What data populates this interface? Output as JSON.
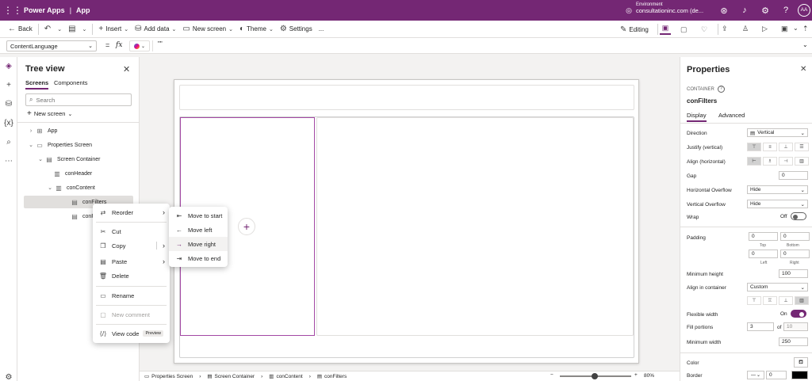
{
  "topbar": {
    "brand": "Power Apps",
    "separator": "|",
    "app": "App",
    "env_label": "Environment",
    "env_name": "consultationinc.com (de...",
    "avatar": "AA",
    "bg": "#742774"
  },
  "cmdbar": {
    "back": "Back",
    "insert": "Insert",
    "add_data": "Add data",
    "new_screen": "New screen",
    "theme": "Theme",
    "settings": "Settings",
    "more": "...",
    "editing": "Editing"
  },
  "formula": {
    "property": "ContentLanguage",
    "equals": "=",
    "fx": "fx",
    "value": "\"\""
  },
  "tree": {
    "title": "Tree view",
    "tabs": [
      "Screens",
      "Components"
    ],
    "search_placeholder": "Search",
    "new_screen": "New screen",
    "nodes": [
      "App",
      "Properties Screen",
      "Screen Container",
      "conHeader",
      "conContent",
      "conFilters",
      "conPro"
    ],
    "more": "..."
  },
  "context_menu": {
    "items": [
      "Reorder",
      "Cut",
      "Copy",
      "Paste",
      "Delete",
      "Rename",
      "New comment",
      "View code"
    ],
    "preview_badge": "Preview"
  },
  "submenu": {
    "items": [
      "Move to start",
      "Move left",
      "Move right",
      "Move to end"
    ]
  },
  "properties": {
    "title": "Properties",
    "kind": "CONTAINER",
    "name": "conFilters",
    "tabs": [
      "Display",
      "Advanced"
    ],
    "direction_label": "Direction",
    "direction_value": "Vertical",
    "justify_label": "Justify (vertical)",
    "align_h_label": "Align (horizontal)",
    "gap_label": "Gap",
    "gap_value": "0",
    "hoverflow_label": "Horizontal Overflow",
    "hoverflow_value": "Hide",
    "voverflow_label": "Vertical Overflow",
    "voverflow_value": "Hide",
    "wrap_label": "Wrap",
    "wrap_value": "Off",
    "padding_label": "Padding",
    "padding_top": "0",
    "padding_bottom": "0",
    "padding_left": "0",
    "padding_right": "0",
    "top_label": "Top",
    "bottom_label": "Bottom",
    "left_label": "Left",
    "right_label": "Right",
    "minheight_label": "Minimum height",
    "minheight_value": "100",
    "align_container_label": "Align in container",
    "align_container_value": "Custom",
    "flexwidth_label": "Flexible width",
    "flexwidth_value": "On",
    "fill_label": "Fill portions",
    "fill_value": "3",
    "fill_of": "of",
    "fill_total": "10",
    "minwidth_label": "Minimum width",
    "minwidth_value": "250",
    "color_label": "Color",
    "border_label": "Border",
    "border_width": "0"
  },
  "statusbar": {
    "crumbs": [
      "Properties Screen",
      "Screen Container",
      "conContent",
      "conFilters"
    ],
    "zoom": "80%"
  },
  "colors": {
    "accent": "#742774",
    "selection_border": "#a349a4"
  }
}
